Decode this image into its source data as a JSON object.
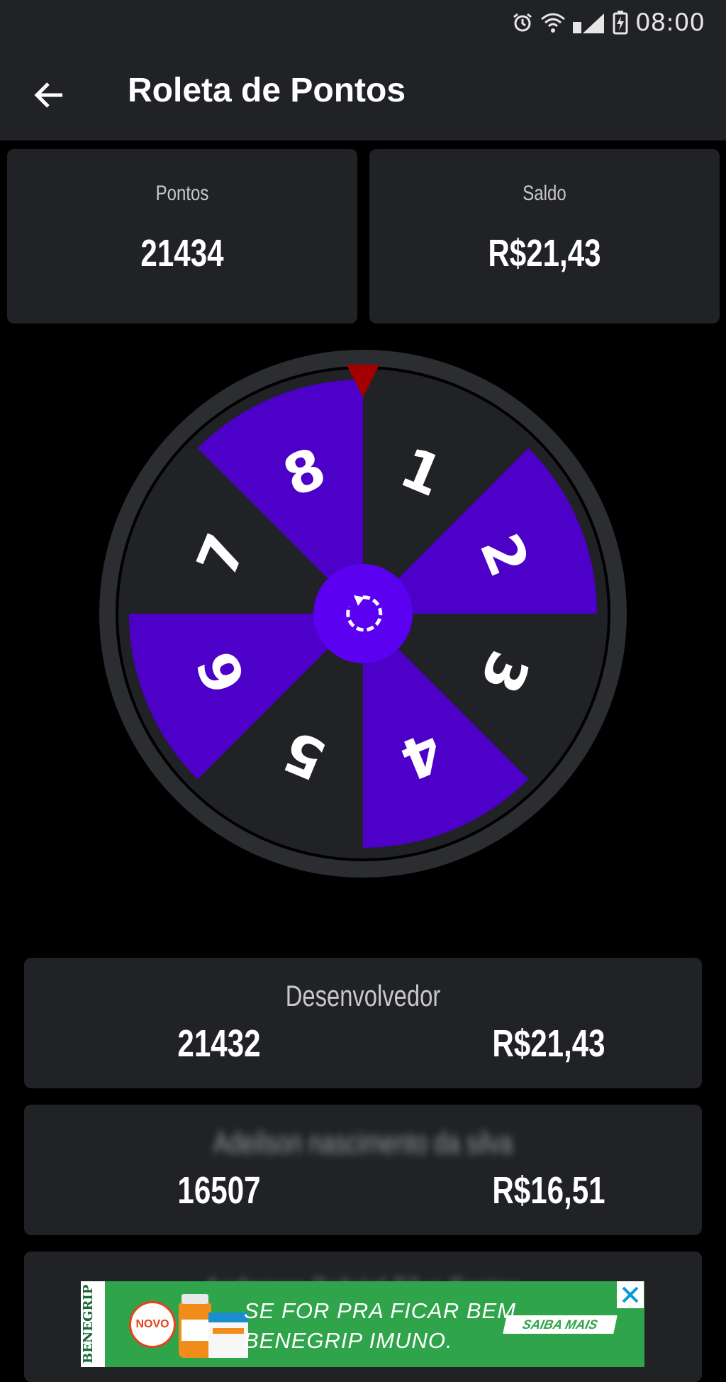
{
  "status_bar": {
    "time": "08:00",
    "icons": [
      "alarm-icon",
      "wifi-icon",
      "signal-icon",
      "battery-charging-icon"
    ]
  },
  "app_bar": {
    "title": "Roleta de Pontos",
    "back_icon": "arrow-back-icon"
  },
  "stats": {
    "points_label": "Pontos",
    "points_value": "21434",
    "balance_label": "Saldo",
    "balance_value": "R$21,43"
  },
  "wheel": {
    "segments": [
      "1",
      "2",
      "3",
      "4",
      "5",
      "6",
      "7",
      "8"
    ],
    "colors": {
      "dark": "#202226",
      "accent": "#4d00c8",
      "spin_button": "#5b00f0",
      "pointer": "#a30000",
      "rim": "#2b2d31"
    },
    "spin_icon": "refresh-icon"
  },
  "ranking": [
    {
      "name": "Desenvolvedor",
      "points": "21432",
      "money": "R$21,43"
    },
    {
      "name": "Adeilson nascimento da silva",
      "points": "16507",
      "money": "R$16,51"
    },
    {
      "name": "Anderson Gabriel Silva Santos",
      "points": "",
      "money": ""
    }
  ],
  "ad": {
    "brand": "BENEGRIP",
    "badge": "NOVO",
    "line1": "SE FOR PRA FICAR BEM,",
    "line2": "BENEGRIP IMUNO.",
    "cta": "SAIBA MAIS",
    "close_icon": "close-icon"
  }
}
